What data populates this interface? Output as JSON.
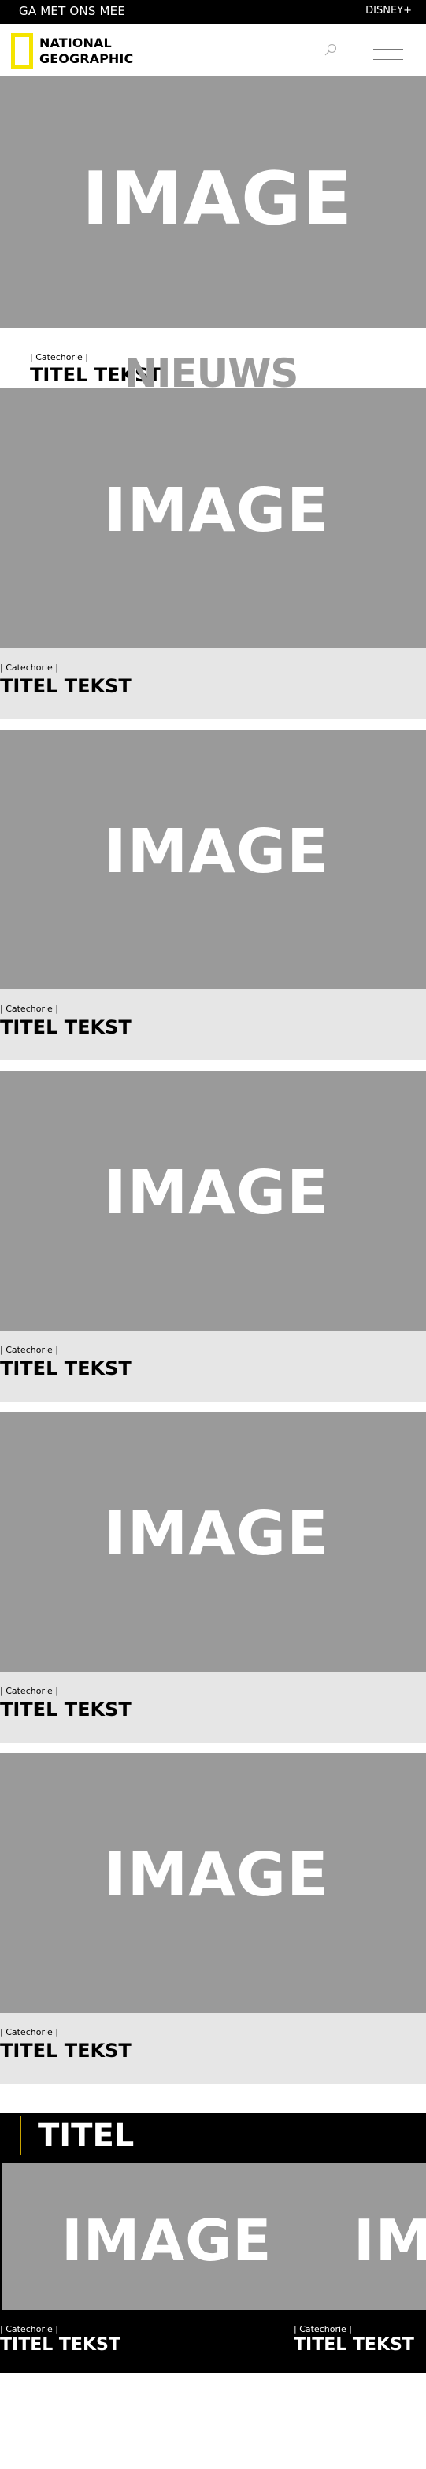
{
  "topbar": {
    "left_label": "GA MET ONS MEE",
    "right_label": "DISNEY+"
  },
  "header": {
    "logo_line1": "NATIONAL",
    "logo_line2": "GEOGRAPHIC",
    "icons": [
      "search-icon",
      "menu-icon"
    ]
  },
  "hero": {
    "image_label": "IMAGE",
    "category": "|   Catechorie   |",
    "title": "TITEL TEKST"
  },
  "section": {
    "heading": "NIEUWS"
  },
  "cards": [
    {
      "image_label": "IMAGE",
      "category": "|   Catechorie   |",
      "title": "TITEL TEKST"
    },
    {
      "image_label": "IMAGE",
      "category": "|   Catechorie   |",
      "title": "TITEL TEKST"
    },
    {
      "image_label": "IMAGE",
      "category": "|   Catechorie   |",
      "title": "TITEL TEKST"
    },
    {
      "image_label": "IMAGE",
      "category": "|   Catechorie   |",
      "title": "TITEL TEKST"
    },
    {
      "image_label": "IMAGE",
      "category": "|   Catechorie   |",
      "title": "TITEL TEKST"
    }
  ],
  "feature": {
    "title": "TITEL",
    "image_label_1": "IMAGE",
    "image_label_2": "IMA",
    "items": [
      {
        "category": "|   Catechorie   |",
        "title": "TITEL TEKST"
      },
      {
        "category": "|   Catechorie   |",
        "title": "TITEL TEKST"
      }
    ]
  },
  "colors": {
    "accent_yellow": "#f5e400",
    "image_gray": "#9a9a9a",
    "card_gray": "#e6e6e6",
    "heading_gray": "#9c9c9c"
  }
}
